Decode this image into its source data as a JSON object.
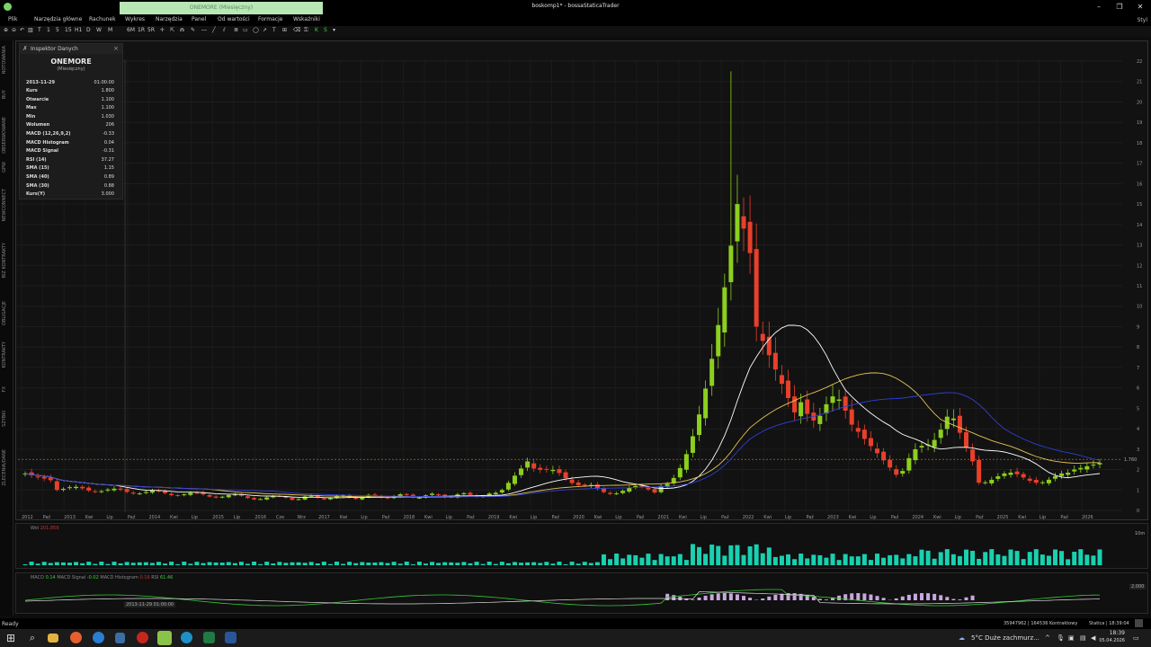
{
  "window": {
    "title": "boskomp1* - bossaStaticaTrader",
    "ghost_tab": "ONEMORE (Miesięczny)",
    "style_label": "Styl"
  },
  "menu": [
    "Plik",
    "Narzędzia główne",
    "Rachunek",
    "Wykres",
    "Narzędzia",
    "Panel",
    "Od wartości",
    "Formacje",
    "Wskaźniki"
  ],
  "toolbar": {
    "intervals": [
      "T",
      "1",
      "5",
      "15",
      "H1",
      "D",
      "W",
      "M",
      "6M",
      "1R",
      "5R"
    ]
  },
  "left_tabs": [
    "NOTOWANIA",
    "BUY",
    "OBSERWOWANE",
    "GPW",
    "NEWCONNECT",
    "BIZ KONTRAKTY",
    "OBLIGACJE",
    "KONTRAKTY",
    "FX",
    "SZYBKI",
    "ZLECENIA/DANE"
  ],
  "inspector": {
    "title": "Inspektor Danych",
    "symbol": "ONEMORE",
    "interval": "(Miesięczny)",
    "date": "2013-11-29",
    "time": "01:00:00",
    "rows": [
      {
        "label": "Kurs",
        "value": "1.800"
      },
      {
        "label": "Otwarcie",
        "value": "1.100"
      },
      {
        "label": "Max",
        "value": "1.100"
      },
      {
        "label": "Min",
        "value": "1.030"
      },
      {
        "label": "Wolumen",
        "value": "206"
      },
      {
        "label": "MACD (12,26,9,2)",
        "value": "-0.33"
      },
      {
        "label": "MACD Histogram",
        "value": "0.04"
      },
      {
        "label": "MACD Signal",
        "value": "-0.31"
      },
      {
        "label": "RSI (14)",
        "value": "37.27"
      },
      {
        "label": "SMA (15)",
        "value": "1.15"
      },
      {
        "label": "SMA (40)",
        "value": "0.89"
      },
      {
        "label": "SMA (30)",
        "value": "0.88"
      },
      {
        "label": "Kurs(Y)",
        "value": "3.000"
      }
    ]
  },
  "chart": {
    "y_ticks": [
      "22",
      "21",
      "20",
      "19",
      "18",
      "17",
      "16",
      "15",
      "14",
      "13",
      "12",
      "11",
      "10",
      "9",
      "8",
      "7",
      "6",
      "5",
      "4",
      "3",
      "2",
      "1",
      "0"
    ],
    "x_labels": [
      "2012",
      "Paź",
      "2013",
      "Kwi",
      "Lip",
      "Paź",
      "2014",
      "Kwi",
      "Lip",
      "2015",
      "Lip",
      "2016",
      "Cze",
      "Wrz",
      "2017",
      "Kwi",
      "Lip",
      "Paź",
      "2018",
      "Kwi",
      "Lip",
      "Paź",
      "2019",
      "Kwi",
      "Lip",
      "Paź",
      "2020",
      "Kwi",
      "Lip",
      "Paź",
      "2021",
      "Kwi",
      "Lip",
      "Paź",
      "2022",
      "Kwi",
      "Lip",
      "Paź",
      "2023",
      "Kwi",
      "Lip",
      "Paź",
      "2024",
      "Kwi",
      "Lip",
      "Paź",
      "2025",
      "Kwi",
      "Lip",
      "Paź",
      "2026"
    ],
    "colors": {
      "up": "#8ccf1e",
      "down": "#e8402a",
      "sma15": "#ffffff",
      "sma30": "#e8c552",
      "sma40": "#2f3fd8",
      "volume": "#18d1b0"
    },
    "price_flag": "1.760"
  },
  "volume_panel": {
    "label": "Wol",
    "value": "201.859",
    "scale": "10m"
  },
  "indicator_panel": {
    "macd_label": "MACD",
    "macd_value": "0.14",
    "signal_label": "MACD Signal",
    "signal_value": "-0.02",
    "hist_label": "MACD Histogram",
    "hist_value": "0.16",
    "rsi_label": "RSI",
    "rsi_value": "61.46",
    "cursor_date": "2013-11-29 01:00:00",
    "scale_value": "2.000"
  },
  "statusbar": {
    "left": "Ready",
    "right": "35947962 | 164536 Kontraktowy",
    "session": "Statica | 18:39:04"
  },
  "taskbar": {
    "weather": "5°C  Duże zachmurz...",
    "time": "18:39",
    "date": "05.04.2026"
  }
}
